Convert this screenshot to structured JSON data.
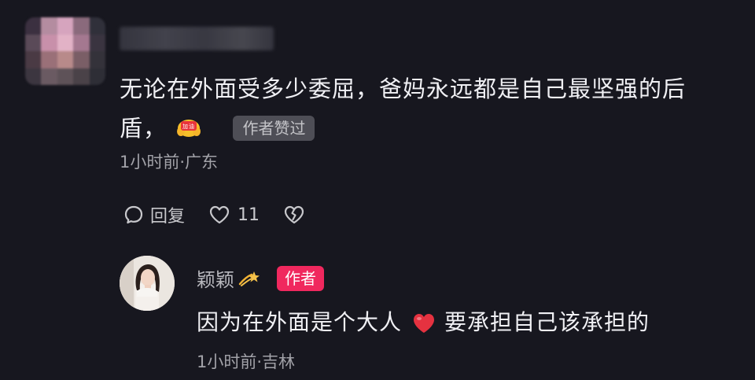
{
  "top_comment": {
    "avatar": "blurred-avatar",
    "username": "",
    "text_line1": "无论在外面受多少委屈，爸妈永远都是自己最坚强的后",
    "text_line2": "盾，",
    "emoji": "加油-emoji",
    "author_liked_badge": "作者赞过",
    "meta": "1小时前·广东",
    "actions": {
      "reply_label": "回复",
      "like_count": "11",
      "reply_icon": "comment-bubble-icon",
      "like_icon": "heart-outline-icon",
      "dislike_icon": "broken-heart-icon"
    }
  },
  "reply": {
    "username": "颖颖",
    "name_emoji": "shooting-star-emoji",
    "author_tag": "作者",
    "text_before": "因为在外面是个大人",
    "text_after": "要承担自己该承担的",
    "heart_emoji": "red-heart-emoji",
    "meta": "1小时前·吉林"
  },
  "colors": {
    "background": "#17171f",
    "author_tag": "#f0285e",
    "author_liked_badge": "#4e4e56",
    "meta_text": "#a2a2a8"
  }
}
